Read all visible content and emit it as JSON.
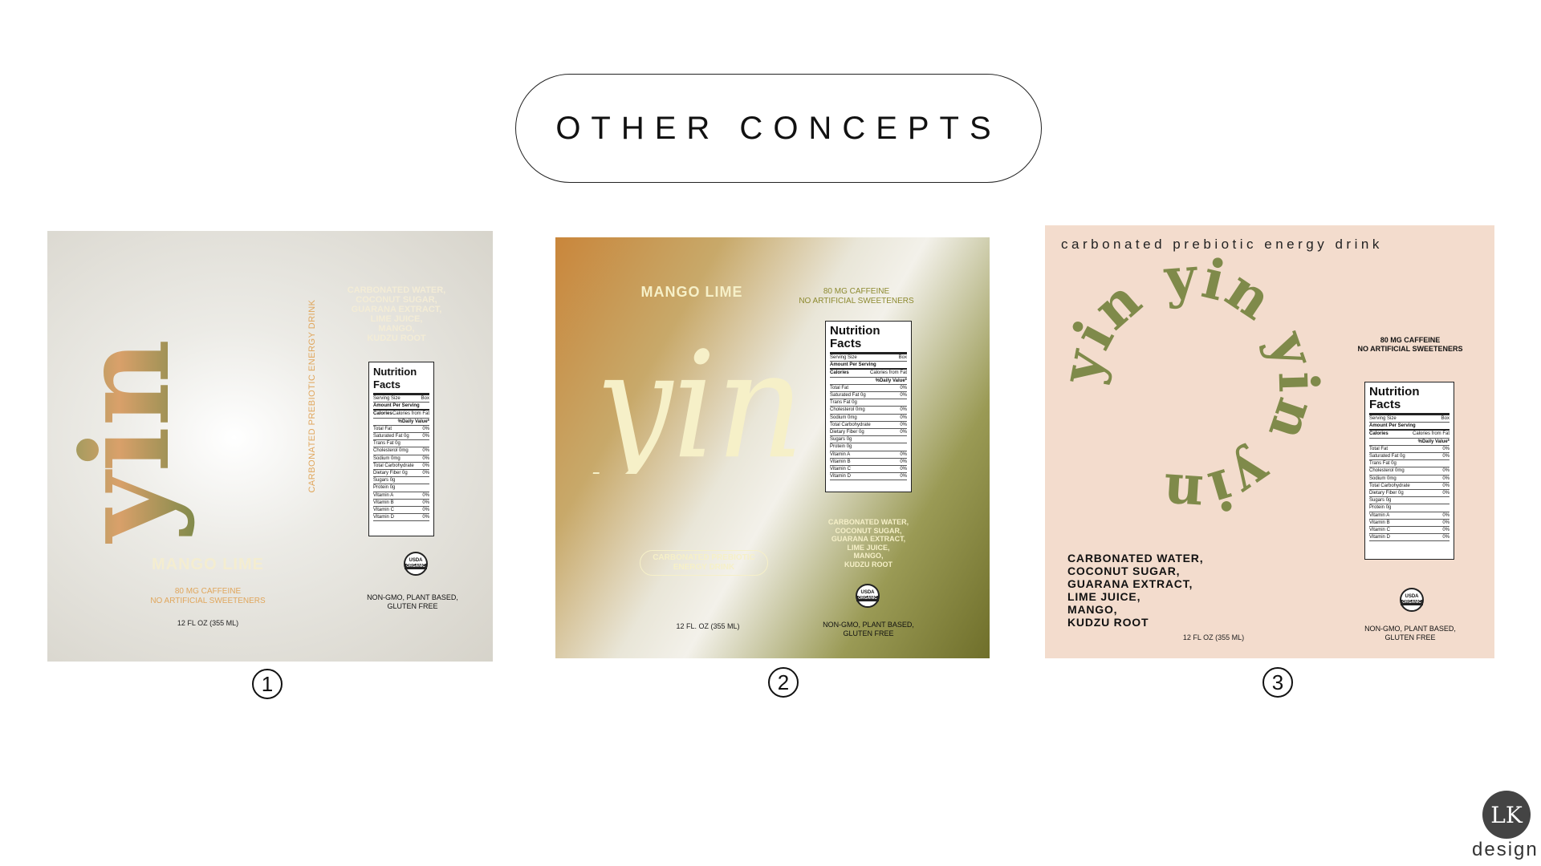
{
  "title": "OTHER CONCEPTS",
  "concepts": [
    {
      "number": "1",
      "brand": "yin",
      "vertical_tagline": "CARBONATED PREBIOTIC ENERGY DRINK",
      "ingredients": "CARBONATED WATER,\nCOCONUT SUGAR,\nGUARANA EXTRACT,\nLIME JUICE,\nMANGO,\nKUDZU ROOT",
      "flavor": "MANGO LIME",
      "caffeine": "80 MG CAFFEINE\nNO ARTIFICIAL SWEETENERS",
      "volume": "12 FL OZ (355 ML)",
      "claims": "NON-GMO, PLANT BASED,\nGLUTEN FREE"
    },
    {
      "number": "2",
      "brand": "yin",
      "flavor": "MANGO LIME",
      "caffeine": "80 MG CAFFEINE\nNO ARTIFICIAL SWEETENERS",
      "badge": "CARBONATED PREBIOTIC\nENERGY DRINK",
      "ingredients": "CARBONATED WATER,\nCOCONUT SUGAR,\nGUARANA EXTRACT,\nLIME JUICE,\nMANGO,\nKUDZU ROOT",
      "volume": "12 FL. OZ (355 ML)",
      "claims": "NON-GMO, PLANT BASED,\nGLUTEN FREE"
    },
    {
      "number": "3",
      "tagline": "carbonated prebiotic energy drink",
      "ring_text": "yin yin yin yin",
      "caffeine": "80 MG CAFFEINE\nNO ARTIFICIAL SWEETENERS",
      "ingredients": "CARBONATED WATER,\nCOCONUT SUGAR,\nGUARANA EXTRACT,\nLIME JUICE,\nMANGO,\nKUDZU ROOT",
      "volume": "12 FL OZ (355 ML)",
      "claims": "NON-GMO, PLANT BASED,\nGLUTEN FREE"
    }
  ],
  "nutrition": {
    "title": "Nutrition Facts",
    "serving_size": "Serving Size",
    "serving_value": "Box",
    "amount_per_serving": "Amount Per Serving",
    "calories": "Calories",
    "calories_from_fat": "Calories from Fat",
    "daily_value": "%Daily Value*",
    "rows": [
      {
        "label": "Total Fat",
        "amount": "",
        "pct": "0%"
      },
      {
        "label": "Saturated Fat",
        "amount": "0g",
        "pct": "0%"
      },
      {
        "label": "Trans Fat",
        "amount": "0g",
        "pct": ""
      },
      {
        "label": "Cholesterol",
        "amount": "0mg",
        "pct": "0%"
      },
      {
        "label": "Sodium",
        "amount": "0mg",
        "pct": "0%"
      },
      {
        "label": "Total Carbohydrate",
        "amount": "",
        "pct": "0%"
      },
      {
        "label": "Dietary Fiber",
        "amount": "0g",
        "pct": "0%"
      },
      {
        "label": "Sugars",
        "amount": "0g",
        "pct": ""
      },
      {
        "label": "Protein",
        "amount": "0g",
        "pct": ""
      },
      {
        "label": "Vitamin A",
        "amount": "",
        "pct": "0%"
      },
      {
        "label": "Vitamin B",
        "amount": "",
        "pct": "0%"
      },
      {
        "label": "Vitamin C",
        "amount": "",
        "pct": "0%"
      },
      {
        "label": "Vitamin D",
        "amount": "",
        "pct": "0%"
      }
    ],
    "usda_top": "USDA",
    "usda_bottom": "ORGANIC"
  },
  "logo": {
    "mark": "LK",
    "word": "design"
  },
  "colors": {
    "olive": "#7f8a4a",
    "sand": "#d89a5a",
    "peach": "#f3dccd",
    "cream": "#f6f0c8"
  }
}
